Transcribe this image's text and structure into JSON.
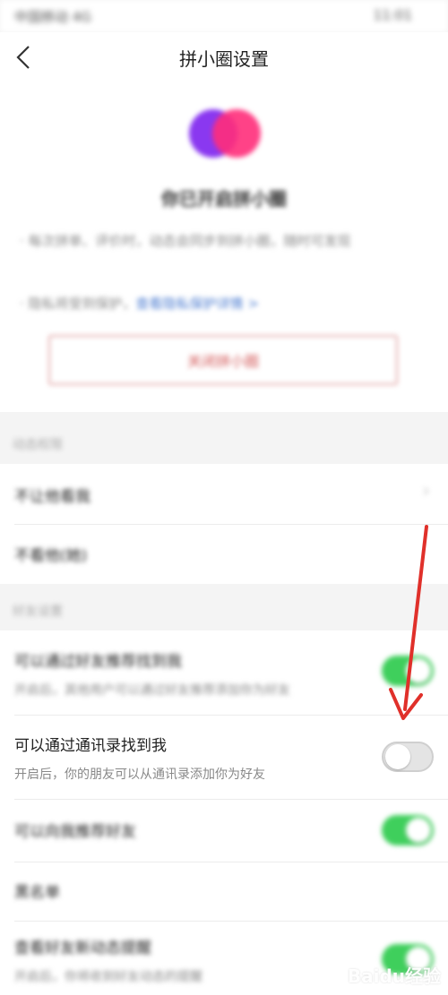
{
  "status_bar": {
    "carrier": "中国移动 4G",
    "time": "11:01"
  },
  "header": {
    "title": "拼小圈设置"
  },
  "intro": {
    "title": "你已开启拼小圈",
    "bullet1": "· 每次拼单、评价时，动态会同步到拼小圈，随时可发现",
    "bullet2_text": "· 隐私将受到保护，",
    "bullet2_link": "查看隐私保护详情 >",
    "close_button": "关闭拼小圈"
  },
  "sections": {
    "dynamic_permission_label": "动态权限",
    "friend_settings_label": "好友设置"
  },
  "rows": {
    "hide_from": "不让他看我",
    "hide_them": "不看他(她)",
    "recommend_title": "可以通过好友推荐找到我",
    "recommend_sub": "开启后，其他用户可以通过好友推荐添加你为好友",
    "contacts_title": "可以通过通讯录找到我",
    "contacts_sub": "开启后，你的朋友可以从通讯录添加你为好友",
    "suggest_title": "可以向我推荐好友",
    "blacklist_title": "黑名单",
    "notify_title": "查看好友新动态提醒",
    "notify_sub": "开启后，你将收到好友动态的提醒"
  },
  "toggles": {
    "recommend": "on",
    "contacts": "off",
    "suggest": "on",
    "notify": "on"
  },
  "icons": {
    "back": "back-arrow-icon",
    "chevron": "chevron-right-icon",
    "logo": "pinxiaoquan-logo-icon",
    "annotation": "red-arrow-annotation"
  },
  "colors": {
    "toggle_on": "#3fcf5c",
    "toggle_off": "#e4e4e4",
    "close_button_text": "#d35a5a",
    "annotation_arrow": "#e0302a"
  },
  "watermark": {
    "text": "Baidu经验"
  }
}
